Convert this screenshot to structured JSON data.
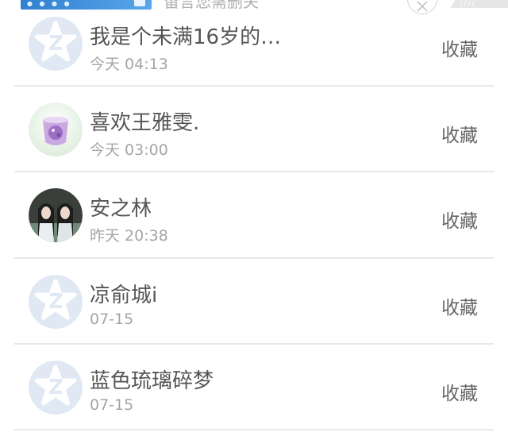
{
  "banner": {
    "text": "留言您需删关",
    "close_icon": "close-icon"
  },
  "items": [
    {
      "name": "我是个未满16岁的…",
      "time": "今天 04:13",
      "action": "收藏",
      "avatar": "default-qq-avatar"
    },
    {
      "name": "喜欢王雅雯.",
      "time": "今天 03:00",
      "action": "收藏",
      "avatar": "photo-avatar-purple-cup"
    },
    {
      "name": "安之林",
      "time": "昨天 20:38",
      "action": "收藏",
      "avatar": "photo-avatar-two-figures"
    },
    {
      "name": "凉俞城i",
      "time": "07-15",
      "action": "收藏",
      "avatar": "default-qq-avatar"
    },
    {
      "name": "蓝色琉璃碎梦",
      "time": "07-15",
      "action": "收藏",
      "avatar": "default-qq-avatar"
    }
  ],
  "colors": {
    "default_avatar_bg": "#dfe8f3",
    "default_avatar_star": "#ffffff",
    "name_text": "#555555",
    "time_text": "#a5a5a5",
    "divider": "#e8e8e8"
  }
}
